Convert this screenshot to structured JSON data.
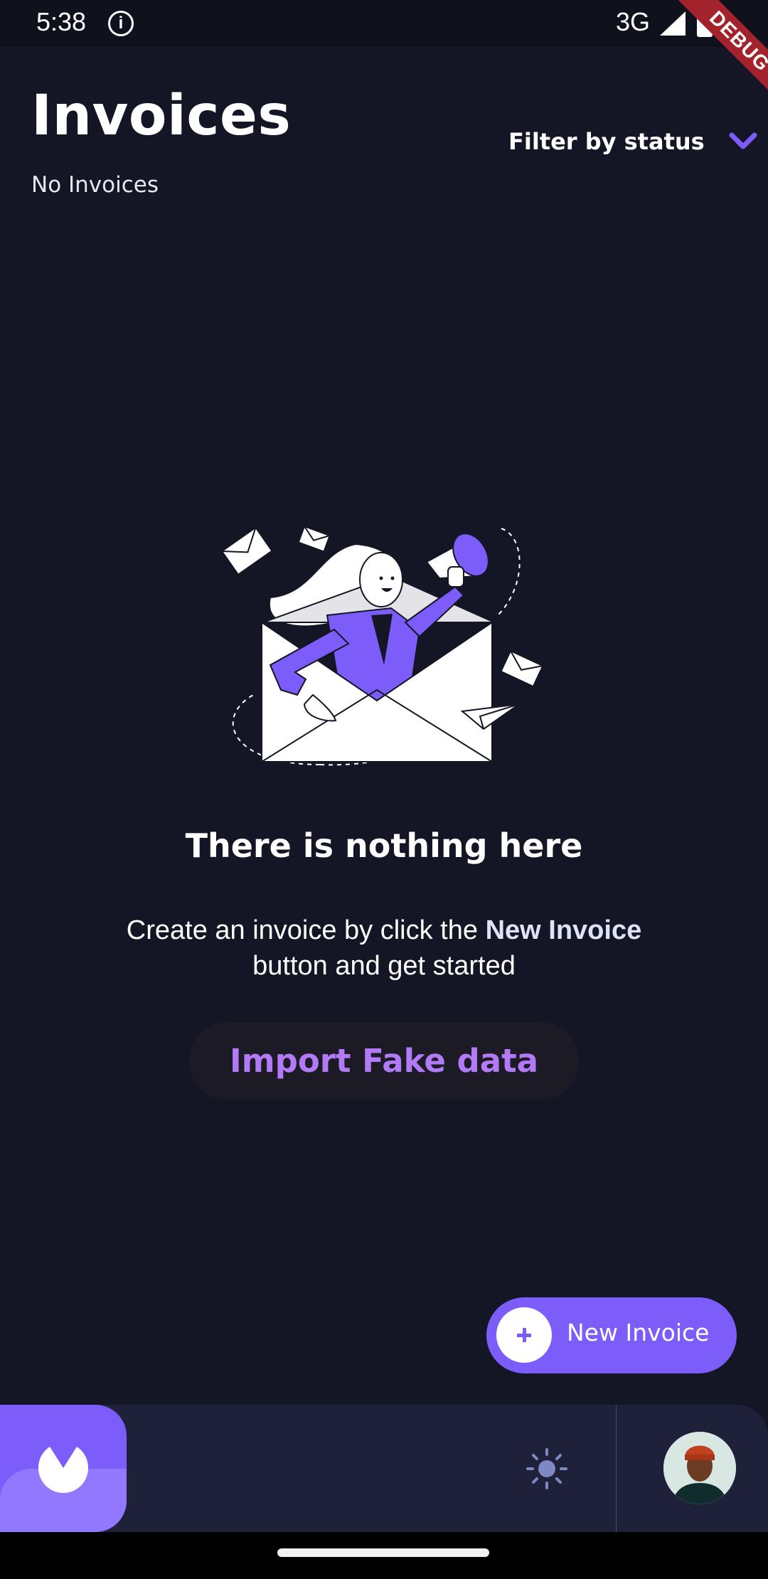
{
  "status_bar": {
    "time": "5:38",
    "network": "3G",
    "debug_label": "DEBUG"
  },
  "header": {
    "title": "Invoices",
    "subtitle": "No Invoices",
    "filter_label": "Filter by status"
  },
  "empty_state": {
    "title": "There is nothing here",
    "description_before": "Create an invoice by click the ",
    "description_highlight": "New Invoice",
    "description_after": " button and get started",
    "import_button_label": "Import Fake data"
  },
  "fab": {
    "label": "New Invoice"
  },
  "bottom_bar": {
    "theme_icon": "sun-icon",
    "avatar": "user-avatar"
  },
  "colors": {
    "background": "#141625",
    "accent": "#7c5dfa",
    "accent_light": "#9277ff",
    "import_text": "#b37af7",
    "bar": "#1e2139"
  }
}
